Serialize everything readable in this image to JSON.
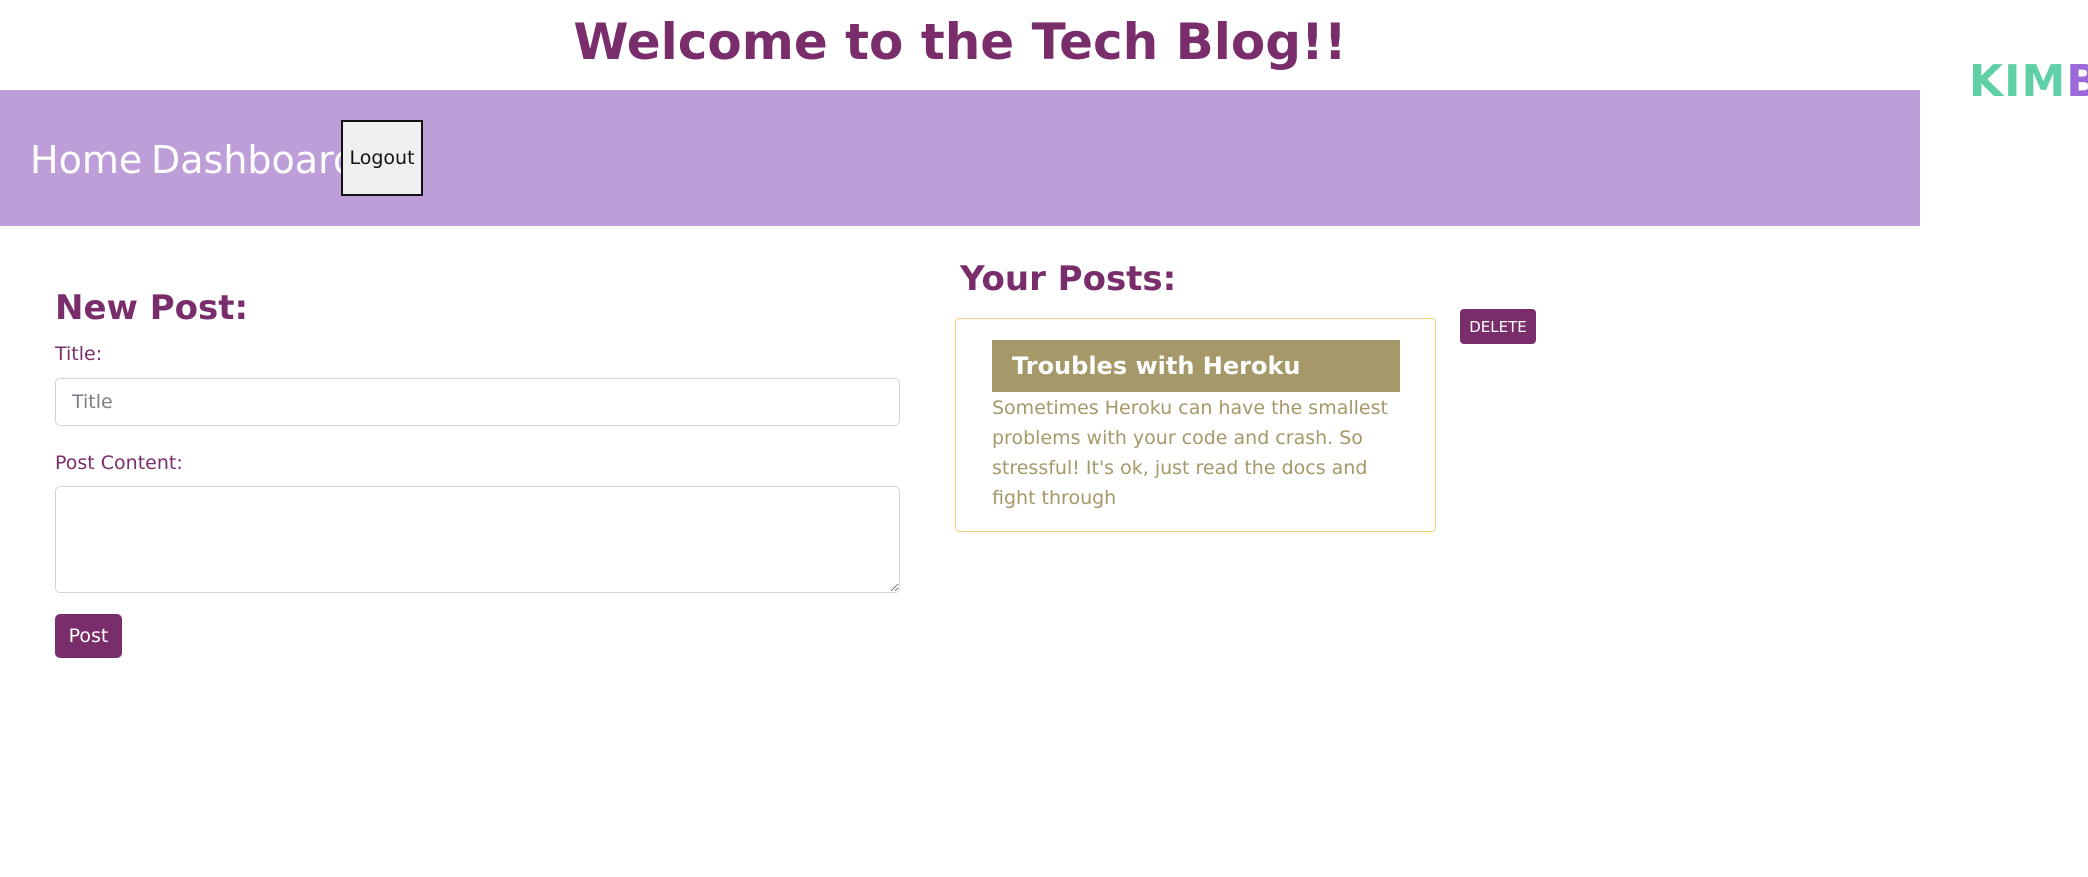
{
  "header": {
    "title": "Welcome to the Tech Blog!!",
    "logo_part1": "KIM",
    "logo_part2": "B"
  },
  "nav": {
    "home": "Home",
    "dashboard": "Dashboard",
    "logout": "Logout"
  },
  "new_post": {
    "heading": "New Post:",
    "title_label": "Title:",
    "title_placeholder": "Title",
    "title_value": "",
    "content_label": "Post Content:",
    "content_value": "",
    "submit_label": "Post"
  },
  "your_posts": {
    "heading": "Your Posts:",
    "posts": [
      {
        "title": "Troubles with Heroku",
        "body": "Sometimes Heroku can have the smallest problems with your code and crash. So stressful! It's ok, just read the docs and fight through",
        "delete_label": "DELETE"
      }
    ]
  },
  "colors": {
    "accent": "#7a2d6b",
    "navbar": "#bd9ed8",
    "card_title_bg": "#a59869",
    "card_border": "#f0d27a",
    "logo_green": "#5fcfa5",
    "logo_purple": "#9b6ad8"
  }
}
